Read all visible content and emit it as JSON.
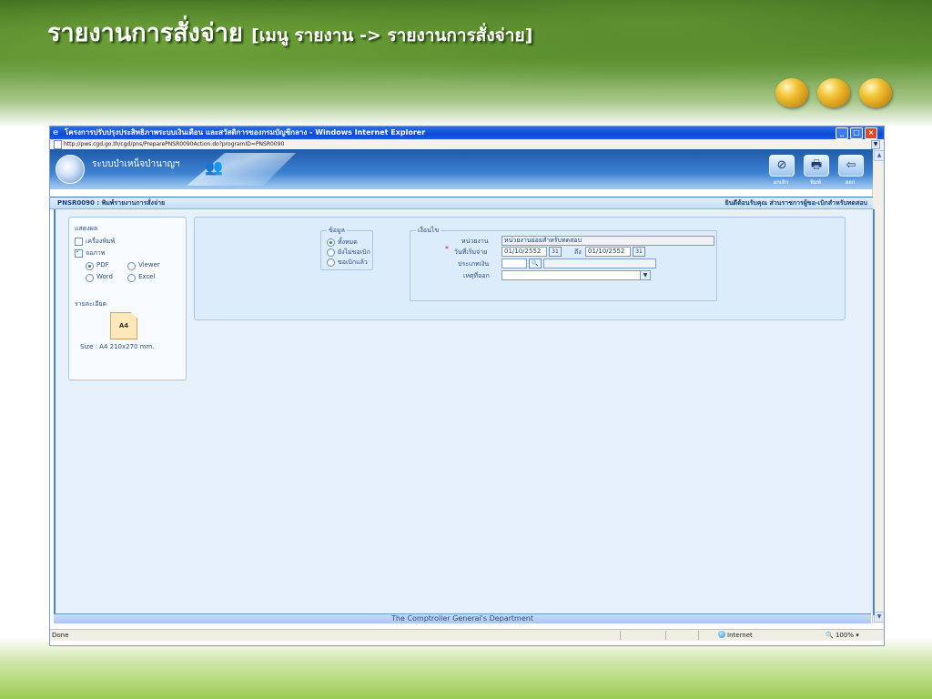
{
  "slide": {
    "title": "รายงานการสั่งจ่าย",
    "subtitle": "[เมนู รายงาน -> รายงานการสั่งจ่าย]"
  },
  "browser": {
    "window_title": "โครงการปรับปรุงประสิทธิภาพระบบเงินเดือน และสวัสดิการของกรมบัญชีกลาง - Windows Internet Explorer",
    "url": "http://pws.cgd.go.th/cgd/pns/PreparePNSR0090Action.do?programID=PNSR0090",
    "status_text": "Done",
    "zone": "Internet",
    "zoom": "100%"
  },
  "app": {
    "system_name": "ระบบบำเหน็จบำนาญฯ",
    "toolbar": {
      "cancel_label": "ยกเลิก",
      "print_label": "พิมพ์",
      "exit_label": "ออก"
    },
    "page_title": "PNSR0090 : พิมพ์รายงานการสั่งจ่าย",
    "welcome": "ยินดีต้อนรับคุณ ส่วนราชการผู้ขอ-เบิกสำหรับทดสอบ",
    "footer": "The Comptroller General's Department"
  },
  "display_panel": {
    "heading": "แสดงผล",
    "printer_label": "เครื่องพิมพ์",
    "screen_label": "จอภาพ",
    "printer_checked": false,
    "screen_checked": true,
    "format_options": [
      {
        "label": "PDF",
        "selected": true
      },
      {
        "label": "Viewer",
        "selected": false
      },
      {
        "label": "Word",
        "selected": false
      },
      {
        "label": "Excel",
        "selected": false
      }
    ],
    "detail_heading": "รายละเอียด",
    "paper_label": "A4",
    "size_text": "Size : A4 210x270 mm."
  },
  "data_group": {
    "legend": "ข้อมูล",
    "options": [
      {
        "label": "ทั้งหมด",
        "selected": true
      },
      {
        "label": "ยังไม่ขอเบิก",
        "selected": false
      },
      {
        "label": "ขอเบิกแล้ว",
        "selected": false
      }
    ]
  },
  "condition_group": {
    "legend": "เงื่อนไข",
    "unit_label": "หน่วยงาน",
    "unit_value": "หน่วยงานย่อยสำหรับทดสอบ",
    "start_date_label": "วันที่เริ่มจ่าย",
    "start_date": "01/10/2552",
    "to_label": "ถึง",
    "end_date": "01/10/2552",
    "money_type_label": "ประเภทเงิน",
    "money_type_value": "",
    "exit_reason_label": "เหตุที่ออก",
    "exit_reason_value": "",
    "calendar_icon": "31",
    "required_mark": "*"
  }
}
